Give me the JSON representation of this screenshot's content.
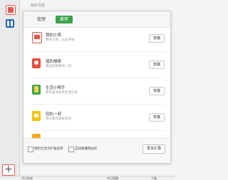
{
  "background": {
    "title": "我的书签"
  },
  "panel": {
    "tabs": [
      {
        "label": "管理"
      },
      {
        "label": "推荐"
      }
    ],
    "items": [
      {
        "name": "我的小窝",
        "desc": "我的小窝，从此开始",
        "install_label": "安装",
        "icon": "gift-icon"
      },
      {
        "name": "猎豹搜索",
        "desc": "搜出你想要的一切",
        "install_label": "安装",
        "icon": "search-app-icon"
      },
      {
        "name": "生活小帮手",
        "desc": "帮你查询各类生活信息",
        "install_label": "安装",
        "icon": "helper-icon"
      },
      {
        "name": "轻松一刻",
        "desc": "每天都有新鲜笑话",
        "install_label": "安装",
        "icon": "smile-icon"
      }
    ],
    "footer": {
      "checkbox1_label": "侧栏栏显示扩展名称",
      "checkbox2_label": "自动隐藏侧边栏",
      "more_label": "更多扩展"
    }
  },
  "statusbar": {
    "left": "今日特卖",
    "mid": "今日直播",
    "right": "下载"
  },
  "colors": {
    "accent": "#3aa24a",
    "red": "#e8564f"
  }
}
